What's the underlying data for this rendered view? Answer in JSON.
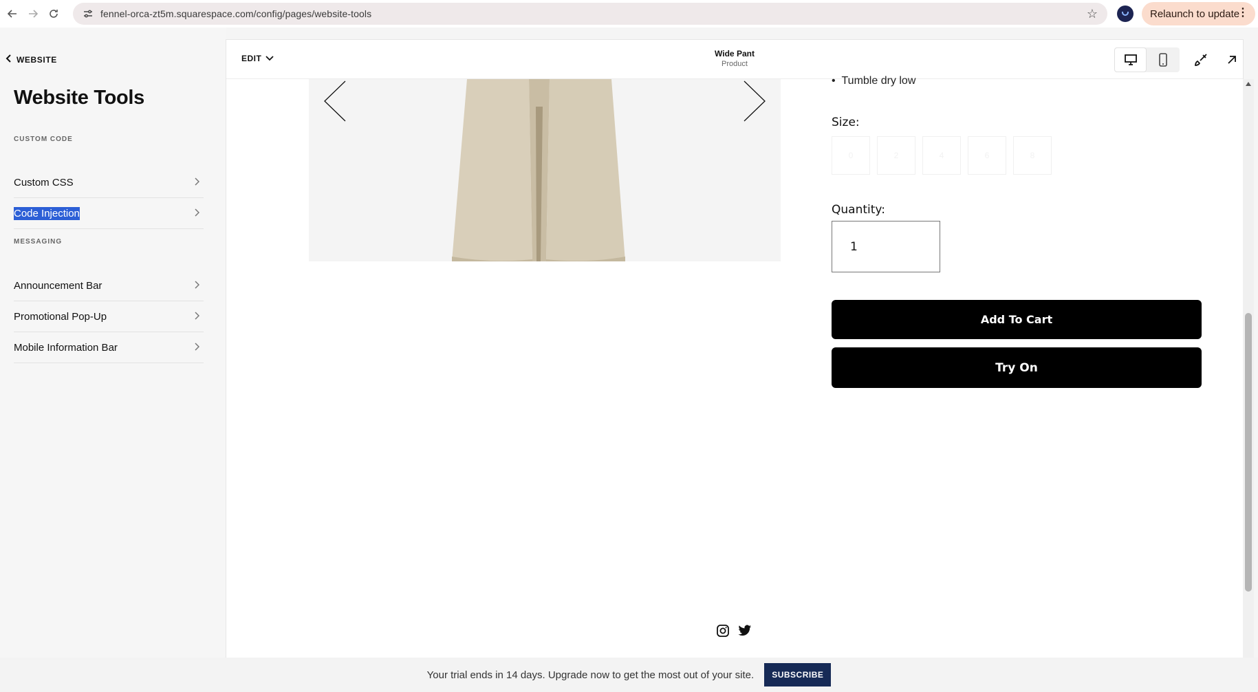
{
  "browser": {
    "url": "fennel-orca-zt5m.squarespace.com/config/pages/website-tools",
    "relaunch_label": "Relaunch to update"
  },
  "sidebar": {
    "back_label": "WEBSITE",
    "title": "Website Tools",
    "sections": [
      {
        "label": "CUSTOM CODE",
        "items": [
          {
            "label": "Custom CSS"
          },
          {
            "label": "Code Injection",
            "selected": true
          }
        ]
      },
      {
        "label": "MESSAGING",
        "items": [
          {
            "label": "Announcement Bar"
          },
          {
            "label": "Promotional Pop-Up"
          },
          {
            "label": "Mobile Information Bar"
          }
        ]
      }
    ]
  },
  "editor": {
    "edit_label": "EDIT",
    "page_title": "Wide Pant",
    "page_subtitle": "Product"
  },
  "product": {
    "care_text": "Tumble dry low",
    "size_label": "Size:",
    "sizes": [
      "0",
      "2",
      "4",
      "6",
      "8"
    ],
    "quantity_label": "Quantity:",
    "quantity_value": "1",
    "add_to_cart_label": "Add To Cart",
    "try_on_label": "Try On"
  },
  "trial_bar": {
    "message": "Your trial ends in 14 days. Upgrade now to get the most out of your site.",
    "subscribe_label": "SUBSCRIBE"
  },
  "icons": {
    "back": "back-arrow-icon",
    "forward": "forward-arrow-icon",
    "reload": "reload-icon",
    "site_settings": "tune-icon",
    "bookmark": "star-icon",
    "desktop": "desktop-icon",
    "mobile": "mobile-icon",
    "style": "paintbrush-icon",
    "open": "external-link-icon",
    "instagram": "instagram-icon",
    "twitter": "twitter-icon"
  },
  "colors": {
    "selection": "#2c5fd6",
    "subscribe_bg": "#162a56",
    "relaunch_bg": "#fbdccd",
    "cta_bg": "#000000"
  }
}
